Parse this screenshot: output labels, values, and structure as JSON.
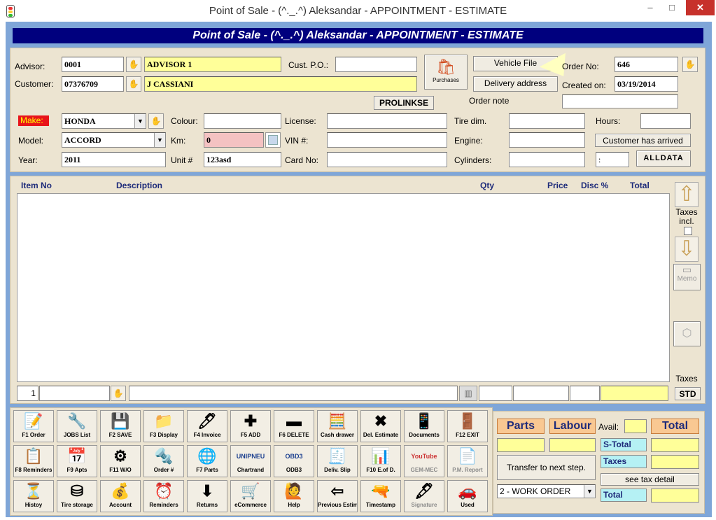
{
  "window": {
    "title": "Point of Sale - (^._.^) Aleksandar - APPOINTMENT - ESTIMATE",
    "minimize": "–",
    "maximize": "□",
    "close": "✕"
  },
  "banner": "Point of Sale - (^._.^) Aleksandar - APPOINTMENT - ESTIMATE",
  "header": {
    "advisor_label": "Advisor:",
    "advisor_code": "0001",
    "advisor_name": "ADVISOR 1",
    "customer_label": "Customer:",
    "customer_code": "07376709",
    "customer_name": "J CASSIANI",
    "cust_po_label": "Cust. P.O.:",
    "cust_po": "",
    "purchases_label": "Purchases",
    "vehicle_file_label": "Vehicle File",
    "delivery_address_label": "Delivery address",
    "order_no_label": "Order No:",
    "order_no": "646",
    "created_on_label": "Created on:",
    "created_on": "03/19/2014",
    "order_note_label": "Order note",
    "order_note": "",
    "prolinkse_label": "PROLINKSE",
    "make_label": "Make:",
    "make": "HONDA",
    "model_label": "Model:",
    "model": "ACCORD",
    "year_label": "Year:",
    "year": "2011",
    "colour_label": "Colour:",
    "colour": "",
    "km_label": "Km:",
    "km": "0",
    "unit_label": "Unit #",
    "unit": "123asd",
    "license_label": "License:",
    "license": "",
    "vin_label": "VIN #:",
    "vin": "",
    "card_label": "Card No:",
    "card": "",
    "tire_label": "Tire dim.",
    "tire": "",
    "engine_label": "Engine:",
    "engine": "",
    "cylinders_label": "Cylinders:",
    "cylinders": "",
    "hours_label": "Hours:",
    "hours": "",
    "arrived_label": "Customer has arrived",
    "time_sep": ":",
    "alldata_label": "ALLDATA"
  },
  "list": {
    "columns": [
      "Item No",
      "Description",
      "Qty",
      "Price",
      "Disc %",
      "Total"
    ],
    "line_number": "1",
    "taxes_incl_label": "Taxes incl.",
    "memo_label": "Memo",
    "taxes_label": "Taxes",
    "std_label": "STD"
  },
  "fkeys": [
    [
      {
        "label": "F1 Order",
        "icon": "order-icon",
        "glyph": "📝",
        "enabled": true
      },
      {
        "label": "JOBS List",
        "icon": "jobs-icon",
        "glyph": "🔧",
        "enabled": true
      },
      {
        "label": "F2 SAVE",
        "icon": "save-icon",
        "glyph": "💾",
        "enabled": true
      },
      {
        "label": "F3 Display",
        "icon": "display-icon",
        "glyph": "📁",
        "enabled": true
      },
      {
        "label": "F4 Invoice",
        "icon": "invoice-icon",
        "glyph": "🖊",
        "enabled": true
      },
      {
        "label": "F5 ADD",
        "icon": "plus-icon",
        "glyph": "✚",
        "enabled": true
      },
      {
        "label": "F6 DELETE",
        "icon": "minus-icon",
        "glyph": "▬",
        "enabled": true
      },
      {
        "label": "Cash drawer",
        "icon": "cash-drawer-icon",
        "glyph": "🧮",
        "enabled": true
      },
      {
        "label": "Del. Estimate",
        "icon": "delete-x-icon",
        "glyph": "✖",
        "enabled": true
      },
      {
        "label": "Documents",
        "icon": "phone-icon",
        "glyph": "📱",
        "enabled": true
      },
      {
        "label": "F12 EXIT",
        "icon": "exit-icon",
        "glyph": "🚪",
        "enabled": true
      }
    ],
    [
      {
        "label": "F8 Reminders",
        "icon": "reminders-note-icon",
        "glyph": "📋",
        "enabled": true
      },
      {
        "label": "F9 Apts",
        "icon": "calendar-icon",
        "glyph": "📅",
        "enabled": true
      },
      {
        "label": "F11 W/O",
        "icon": "gear-icon",
        "glyph": "⚙",
        "enabled": true
      },
      {
        "label": "Order #",
        "icon": "cylinder-icon",
        "glyph": "🔩",
        "enabled": true
      },
      {
        "label": "F7 Parts",
        "icon": "globe-icon",
        "glyph": "🌐",
        "enabled": true
      },
      {
        "label": "Chartrand",
        "icon": "unipneu-logo-icon",
        "glyph": "UNIPNEU",
        "enabled": true
      },
      {
        "label": "ODB3",
        "icon": "obd3-logo-icon",
        "glyph": "OBD3",
        "enabled": true
      },
      {
        "label": "Deliv. Slip",
        "icon": "delivery-slip-icon",
        "glyph": "🧾",
        "enabled": true
      },
      {
        "label": "F10 E.of D.",
        "icon": "end-of-day-icon",
        "glyph": "📊",
        "enabled": true
      },
      {
        "label": "GEM-MEC",
        "icon": "youtube-icon",
        "glyph": "YouTube",
        "enabled": false
      },
      {
        "label": "P.M. Report",
        "icon": "report-icon",
        "glyph": "📄",
        "enabled": false
      }
    ],
    [
      {
        "label": "Histoy",
        "icon": "history-icon",
        "glyph": "⏳",
        "enabled": true
      },
      {
        "label": "Tire storage",
        "icon": "tire-icon",
        "glyph": "⛁",
        "enabled": true
      },
      {
        "label": "Account",
        "icon": "account-icon",
        "glyph": "💰",
        "enabled": true
      },
      {
        "label": "Reminders",
        "icon": "reminders-icon",
        "glyph": "⏰",
        "enabled": true
      },
      {
        "label": "Returns",
        "icon": "returns-icon",
        "glyph": "⬇",
        "enabled": true
      },
      {
        "label": "eCommerce",
        "icon": "cart-icon",
        "glyph": "🛒",
        "enabled": true
      },
      {
        "label": "Help",
        "icon": "help-icon",
        "glyph": "🙋",
        "enabled": true
      },
      {
        "label": "Previous Estimate",
        "icon": "back-arrow-icon",
        "glyph": "⇦",
        "enabled": true
      },
      {
        "label": "Timestamp",
        "icon": "scanner-icon",
        "glyph": "🔫",
        "enabled": true
      },
      {
        "label": "Signature",
        "icon": "pen-icon",
        "glyph": "🖋",
        "enabled": false
      },
      {
        "label": "Used",
        "icon": "car-icon",
        "glyph": "🚗",
        "enabled": true
      }
    ]
  ],
  "totals": {
    "parts_label": "Parts",
    "labour_label": "Labour",
    "avail_label": "Avail:",
    "total_label": "Total",
    "transfer_label": "Transfer to next step.",
    "stotal_label": "S-Total",
    "taxes_label": "Taxes",
    "see_tax_label": "see tax detail",
    "step_select": "2 - WORK ORDER",
    "total_row_label": "Total"
  }
}
